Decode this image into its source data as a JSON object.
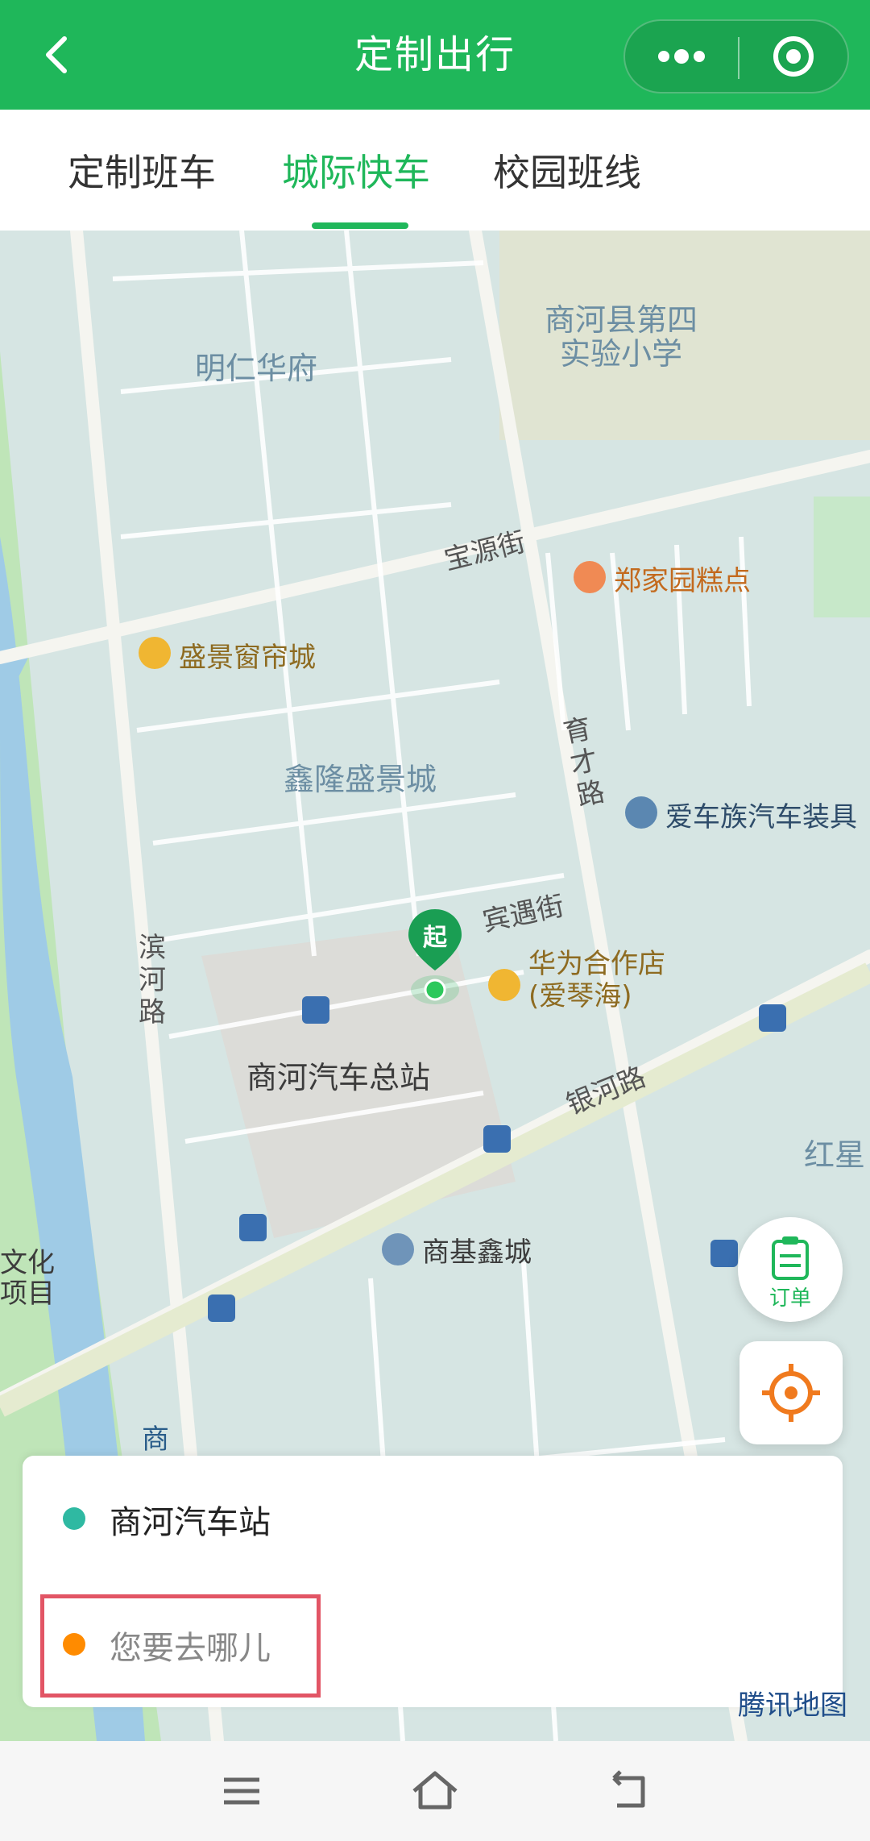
{
  "header": {
    "title": "定制出行"
  },
  "tabs": [
    {
      "label": "定制班车",
      "active": false
    },
    {
      "label": "城际快车",
      "active": true
    },
    {
      "label": "校园班线",
      "active": false
    }
  ],
  "map": {
    "labels": {
      "minren": "明仁华府",
      "school": "商河县第四\n实验小学",
      "baoyuan": "宝源街",
      "zhengjia": "郑家园糕点",
      "shengjing": "盛景窗帘城",
      "xinlong": "鑫隆盛景城",
      "yucai": "育才路",
      "aiche": "爱车族汽车装具",
      "binyu": "宾遇街",
      "huawei": "华为合作店\n(爱琴海)",
      "binhe": "滨河路",
      "station": "商河汽车总站",
      "yinhe": "银河路",
      "hongxing": "红星",
      "shangji": "商基鑫城",
      "wenhua": "文化\n项目",
      "shang": "商",
      "pin_char": "起",
      "brand": "腾讯地图"
    }
  },
  "buttons": {
    "order": "订单"
  },
  "route": {
    "start": "商河汽车站",
    "destination_placeholder": "您要去哪儿"
  },
  "colors": {
    "primary": "#1fb75a",
    "start_dot": "#2fb9a2",
    "dest_dot": "#ff8b00",
    "highlight": "#e25565"
  }
}
